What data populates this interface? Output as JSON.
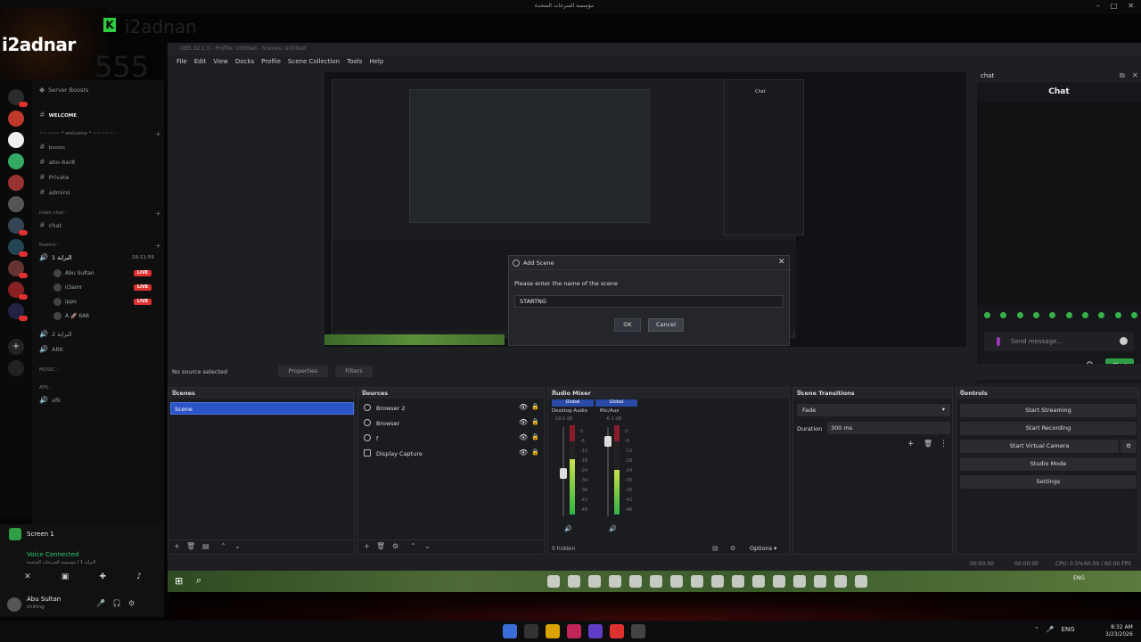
{
  "stream": {
    "top_title": "مؤسسة السرحات المتحدة",
    "brand_name": "i2adnar",
    "brand_k": "K",
    "ghost_name": "i2adnan",
    "ghost_number": "555"
  },
  "discord": {
    "channels": [
      {
        "label": "Server Boosts",
        "type": "text"
      },
      {
        "label": "WELCOME",
        "type": "text"
      },
      {
        "label": "~~~~~ * welcome * ~~~~~ -",
        "type": "category"
      },
      {
        "label": "boosts",
        "type": "text"
      },
      {
        "label": "abo-6ar8",
        "type": "text"
      },
      {
        "label": "Private",
        "type": "text"
      },
      {
        "label": "admins",
        "type": "text"
      },
      {
        "label": "main chat -",
        "type": "category"
      },
      {
        "label": "chat",
        "type": "text"
      },
      {
        "label": "Rooms -",
        "type": "category"
      },
      {
        "label": "البراية 1",
        "type": "voice",
        "time": "16:11:59"
      },
      {
        "label": "البراية 2",
        "type": "voice"
      },
      {
        "label": "ARK",
        "type": "voice"
      },
      {
        "label": "MUSIC -",
        "type": "category"
      },
      {
        "label": "AFK -",
        "type": "category"
      },
      {
        "label": "afk",
        "type": "voice"
      }
    ],
    "voice_users": [
      {
        "name": "Abu Sultan",
        "live": "LIVE"
      },
      {
        "name": "ii3amr",
        "live": "LIVE"
      },
      {
        "name": "ippo",
        "live": "LIVE"
      },
      {
        "name": "A 🚀 6A6",
        "live": ""
      }
    ],
    "panel": {
      "screen_label": "Screen 1",
      "voice_connected": "Voice Connected",
      "voice_sub": "البراية 1 / مؤسسة السرحات المتحدة",
      "username": "Abu Sultan",
      "user_status": "chilling"
    }
  },
  "obs": {
    "window_title": "OBS 32.1.0 - Profile: Untitled - Scenes: Untitled",
    "menu": [
      "File",
      "Edit",
      "View",
      "Docks",
      "Profile",
      "Scene Collection",
      "Tools",
      "Help"
    ],
    "dialog": {
      "title": "Add Scene",
      "prompt": "Please enter the name of the scene",
      "input_value": "STARTNG",
      "ok_label": "OK",
      "cancel_label": "Cancel"
    },
    "chat_dock": {
      "header": "chat",
      "title": "Chat",
      "placeholder": "Send message...",
      "send_label": "Chat"
    },
    "nested_chat_title": "Chat",
    "source_toolbar": {
      "no_source": "No source selected",
      "properties": "Properties",
      "filters": "Filters"
    },
    "docks": {
      "scenes_title": "Scenes",
      "scenes": [
        "Scene"
      ],
      "sources_title": "Sources",
      "sources": [
        "Browser 2",
        "Browser",
        "f",
        "Display Capture"
      ],
      "mixer_title": "Audio Mixer",
      "mixer_tabs": [
        "Global",
        "Global"
      ],
      "mixer_labels": [
        "Desktop Audio",
        "Mic/Aux"
      ],
      "mixer_db": [
        "-19.0 dB",
        "-6.1 dB"
      ],
      "mixer_scale": [
        "0",
        "-6",
        "-12",
        "-18",
        "-24",
        "-30",
        "-36",
        "-42",
        "-48",
        "-54",
        "-60"
      ],
      "mixer_hidden": "0 hidden",
      "mixer_options": "Options",
      "transitions_title": "Scene Transitions",
      "transition_value": "Fade",
      "duration_label": "Duration",
      "duration_value": "300 ms",
      "controls_title": "Controls",
      "controls": [
        "Start Streaming",
        "Start Recording",
        "Start Virtual Camera",
        "Studio Mode",
        "Settings"
      ]
    },
    "status": {
      "time1": "00:00:00",
      "time2": "00:00:00",
      "cpu": "CPU: 0.5%",
      "fps": "60.00 / 60.00 FPS"
    }
  },
  "taskbar": {
    "lang": "ENG",
    "clock_time": "8:32 AM",
    "clock_date": "3/23/2026",
    "inner_lang": "ENG"
  }
}
